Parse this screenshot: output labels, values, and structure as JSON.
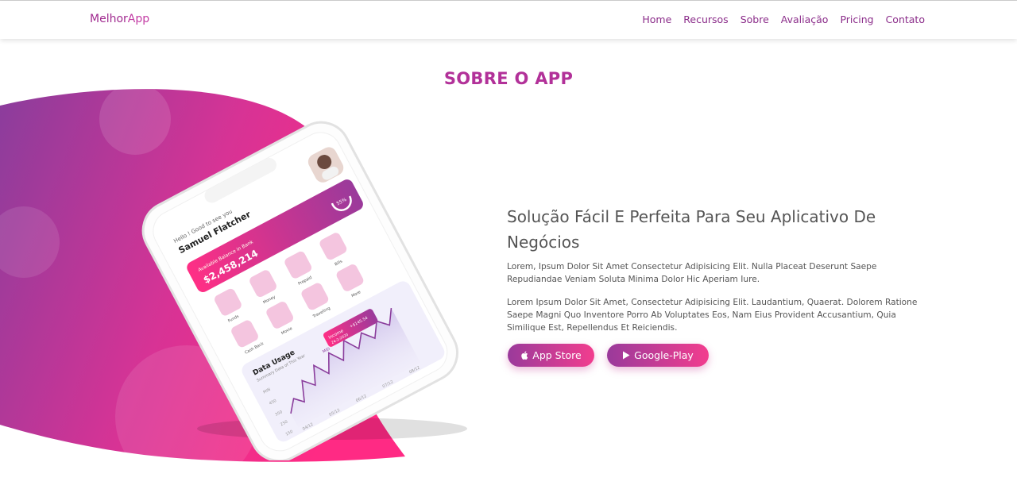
{
  "brand": {
    "part1": "Melhor",
    "part2": "App"
  },
  "nav": [
    {
      "label": "Home"
    },
    {
      "label": "Recursos"
    },
    {
      "label": "Sobre"
    },
    {
      "label": "Avaliação"
    },
    {
      "label": "Pricing"
    },
    {
      "label": "Contato"
    }
  ],
  "section_title": "SOBRE O APP",
  "phone": {
    "greeting": "Hello ! Good to see you",
    "user_name": "Samuel Flatcher",
    "balance_label": "Available Balance in Bank",
    "balance": "$2,458,214",
    "progress": "55%",
    "menu": [
      "Bills",
      "Money",
      "Prepaid",
      "More",
      "Funds",
      "Movie",
      "Travelling",
      "Cash Back"
    ],
    "chart_title": "Data Usage",
    "chart_subtitle": "Summary Data of This Year",
    "income_label": "Income",
    "income_value": "+$145.54",
    "income_date": "24-2-2020",
    "mid_label": "MID",
    "y_axis": [
      "MIN",
      "450",
      "350",
      "250",
      "150"
    ],
    "x_axis": [
      "04/12",
      "05/12",
      "06/12",
      "07/12",
      "08/12"
    ]
  },
  "content": {
    "headline": "Solução Fácil E Perfeita Para Seu Aplicativo De Negócios",
    "para1": "Lorem, Ipsum Dolor Sit Amet Consectetur Adipisicing Elit. Nulla Placeat Deserunt Saepe Repudiandae Veniam Soluta Minima Dolor Hic Aperiam Iure.",
    "para2": "Lorem Ipsum Dolor Sit Amet, Consectetur Adipisicing Elit. Laudantium, Quaerat. Dolorem Ratione Saepe Magni Quo Inventore Porro Ab Voluptates Eos, Nam Eius Provident Accusantium, Quia Similique Est, Repellendus Et Reiciendis."
  },
  "buttons": {
    "app_store": "App Store",
    "google_play": "Google-Play"
  },
  "icons": {
    "apple": "apple-icon",
    "play": "play-icon"
  },
  "colors": {
    "accent": "#b23199",
    "gradient_start": "#8a3d9c",
    "gradient_end": "#ff2f85",
    "text": "#555555"
  }
}
